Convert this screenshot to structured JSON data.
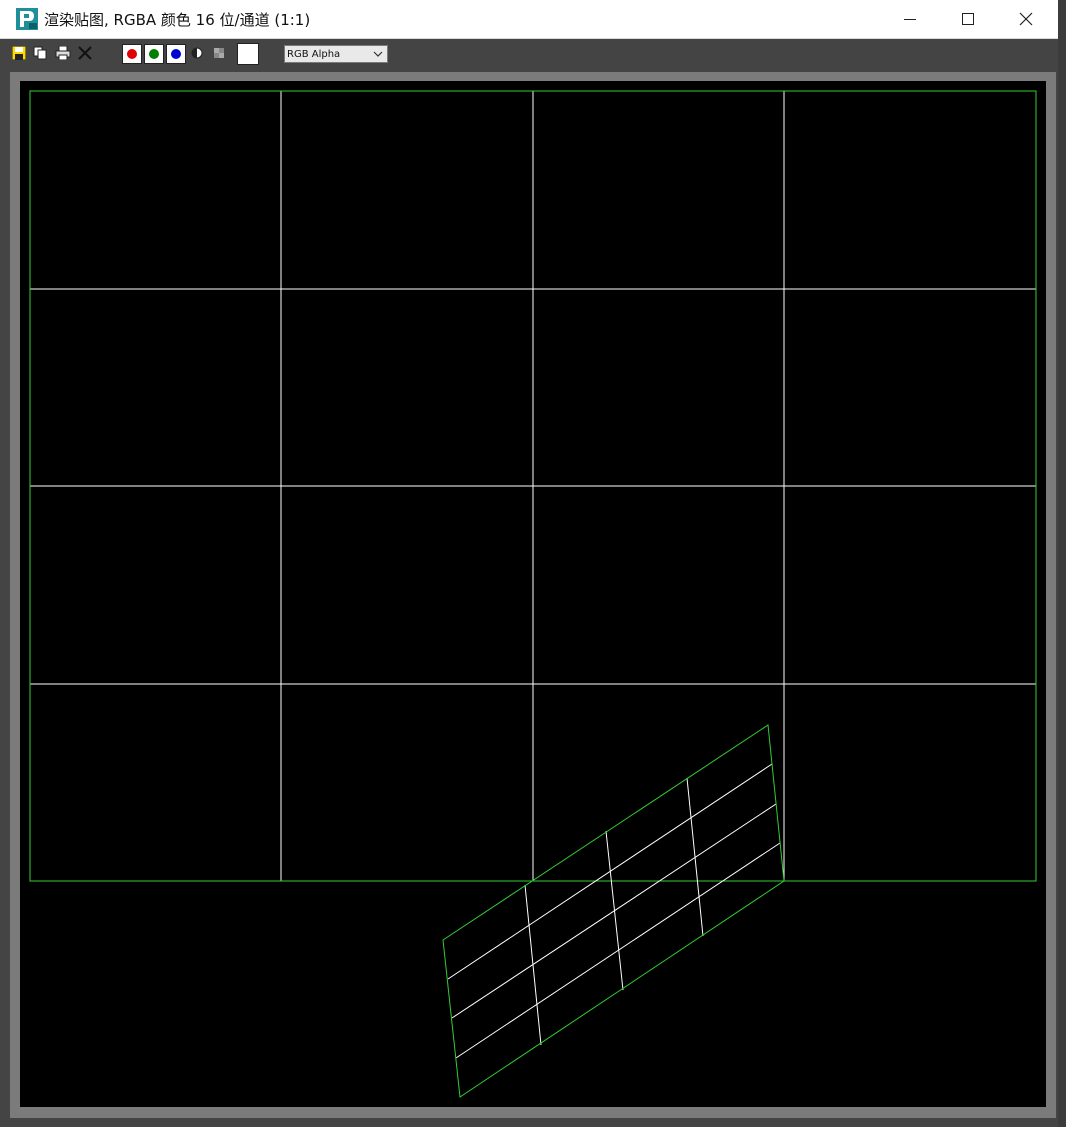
{
  "window": {
    "title": "渲染贴图, RGBA 颜色 16 位/通道 (1:1)",
    "controls": [
      "minimize",
      "maximize",
      "close"
    ]
  },
  "toolbar": {
    "icons": [
      "save-icon",
      "copy-icon",
      "print-icon",
      "clear-icon"
    ],
    "channels": [
      "red",
      "green",
      "blue"
    ],
    "channel_colors": {
      "red": "#e00000",
      "green": "#008000",
      "blue": "#0000d0"
    },
    "display_mode": "RGB Alpha"
  },
  "colors": {
    "canvas_bg": "#000000",
    "grid_line": "#ffffff",
    "border_line": "#33cc33"
  }
}
